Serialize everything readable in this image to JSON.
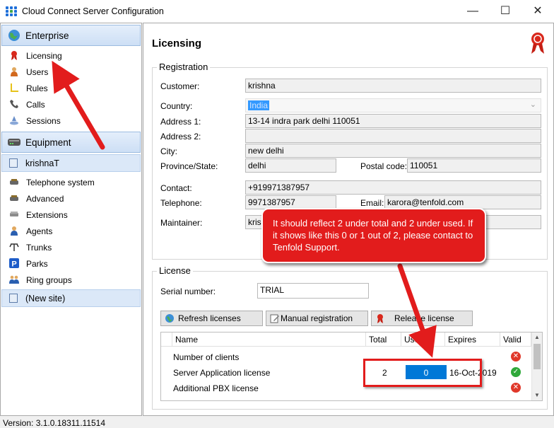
{
  "window": {
    "title": "Cloud Connect Server Configuration",
    "minimize": "—",
    "maximize": "☐",
    "close": "✕"
  },
  "sidebar": {
    "enterprise": {
      "header": "Enterprise",
      "items": [
        {
          "label": "Licensing",
          "icon": "ribbon-icon"
        },
        {
          "label": "Users",
          "icon": "user-icon"
        },
        {
          "label": "Rules",
          "icon": "rules-icon"
        },
        {
          "label": "Calls",
          "icon": "phone-handset-icon"
        },
        {
          "label": "Sessions",
          "icon": "sessions-icon"
        }
      ]
    },
    "equipment": {
      "header": "Equipment",
      "site": "krishnaT",
      "items": [
        {
          "label": "Telephone system",
          "icon": "pbx-icon"
        },
        {
          "label": "Advanced",
          "icon": "advanced-icon"
        },
        {
          "label": "Extensions",
          "icon": "extensions-icon"
        },
        {
          "label": "Agents",
          "icon": "agent-icon"
        },
        {
          "label": "Trunks",
          "icon": "trunk-icon"
        },
        {
          "label": "Parks",
          "icon": "parking-icon"
        },
        {
          "label": "Ring groups",
          "icon": "ring-groups-icon"
        }
      ],
      "new_site": "(New site)"
    }
  },
  "main": {
    "title": "Licensing",
    "registration": {
      "group_title": "Registration",
      "customer_label": "Customer:",
      "customer": "krishna",
      "country_label": "Country:",
      "country": "India",
      "address1_label": "Address 1:",
      "address1": "13-14 indra park delhi 110051",
      "address2_label": "Address 2:",
      "address2": "",
      "city_label": "City:",
      "city": "new delhi",
      "province_label": "Province/State:",
      "province": "delhi",
      "postal_label": "Postal code:",
      "postal": "110051",
      "contact_label": "Contact:",
      "contact": "+919971387957",
      "telephone_label": "Telephone:",
      "telephone": "9971387957",
      "email_label": "Email:",
      "email": "karora@tenfold.com",
      "maintainer_label": "Maintainer:",
      "maintainer": "kris"
    },
    "license": {
      "group_title": "License",
      "serial_label": "Serial number:",
      "serial": "TRIAL",
      "refresh_button": "Refresh licenses",
      "manual_button": "Manual registration",
      "release_button": "Release license",
      "columns": [
        "Name",
        "Total",
        "Used",
        "Expires",
        "Valid"
      ],
      "rows": [
        {
          "name": "Number of clients",
          "total": "",
          "used": "",
          "expires": "",
          "valid": false
        },
        {
          "name": "Server Application license",
          "total": "2",
          "used": "0",
          "expires": "16-Oct-2019",
          "valid": true
        },
        {
          "name": "Additional PBX license",
          "total": "",
          "used": "",
          "expires": "",
          "valid": false
        }
      ]
    }
  },
  "status": {
    "version": "Version: 3.1.0.18311.11514"
  },
  "annotation": {
    "callout": "It should reflect 2 under total and 2 under used. If it shows like this 0 or 1 out of 2, please contact to Tenfold Support.",
    "color": "#e21c1c"
  }
}
